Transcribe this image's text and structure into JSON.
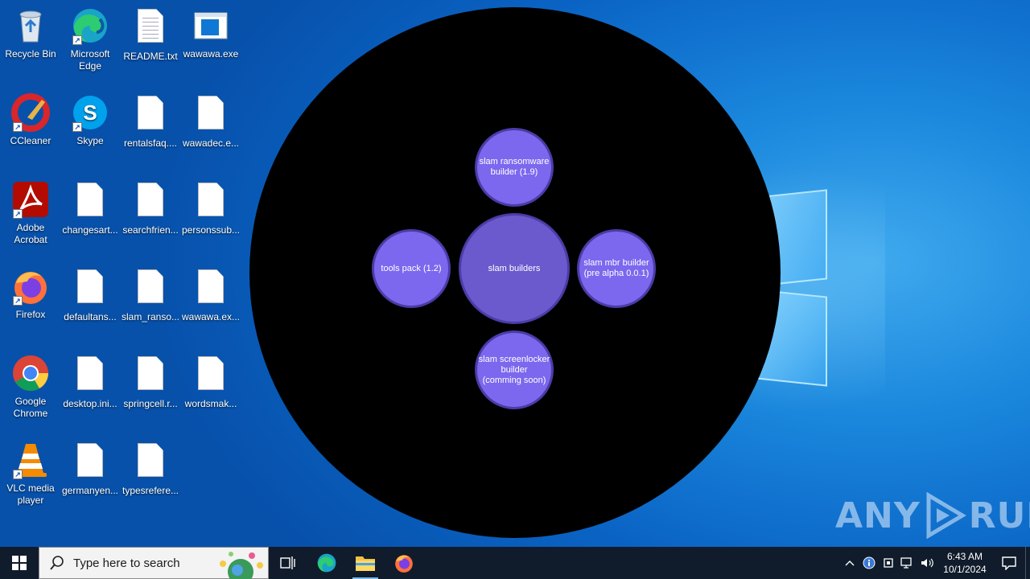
{
  "desktop": {
    "icons": [
      {
        "label": "Recycle Bin",
        "icon": "recycle-bin-icon"
      },
      {
        "label": "Microsoft Edge",
        "icon": "edge-icon"
      },
      {
        "label": "README.txt",
        "icon": "text-file-icon"
      },
      {
        "label": "wawawa.exe",
        "icon": "exe-window-icon"
      },
      {
        "label": "CCleaner",
        "icon": "ccleaner-icon"
      },
      {
        "label": "Skype",
        "icon": "skype-icon"
      },
      {
        "label": "rentalsfaq....",
        "icon": "file-icon"
      },
      {
        "label": "wawadec.e...",
        "icon": "file-icon"
      },
      {
        "label": "Adobe Acrobat",
        "icon": "acrobat-icon"
      },
      {
        "label": "changesart...",
        "icon": "file-icon"
      },
      {
        "label": "searchfrien...",
        "icon": "file-icon"
      },
      {
        "label": "personssub...",
        "icon": "file-icon"
      },
      {
        "label": "Firefox",
        "icon": "firefox-icon"
      },
      {
        "label": "defaultans...",
        "icon": "file-icon"
      },
      {
        "label": "slam_ranso...",
        "icon": "file-icon"
      },
      {
        "label": "wawawa.ex...",
        "icon": "file-icon"
      },
      {
        "label": "Google Chrome",
        "icon": "chrome-icon"
      },
      {
        "label": "desktop.ini...",
        "icon": "file-icon"
      },
      {
        "label": "springcell.r...",
        "icon": "file-icon"
      },
      {
        "label": "wordsmak...",
        "icon": "file-icon"
      },
      {
        "label": "VLC media player",
        "icon": "vlc-icon"
      },
      {
        "label": "germanyen...",
        "icon": "file-icon"
      },
      {
        "label": "typesrefere...",
        "icon": "file-icon"
      }
    ]
  },
  "app": {
    "center": "slam builders",
    "top": "slam ransomware\nbuilder (1.9)",
    "left": "tools pack (1.2)",
    "right": "slam mbr builder\n(pre alpha 0.0.1)",
    "bottom": "slam screenlocker\nbuilder\n(comming soon)"
  },
  "watermark": {
    "left": "ANY",
    "right": "RUN"
  },
  "taskbar": {
    "search_placeholder": "Type here to search",
    "apps": [
      "task-view-icon",
      "edge-icon",
      "file-explorer-icon",
      "firefox-icon"
    ],
    "time": "6:43 AM",
    "date": "10/1/2024"
  },
  "colors": {
    "bubble": "#7b68ee",
    "bubble_center": "#6a5acd",
    "bubble_border": "#4b3ca8",
    "taskbar": "#101c2b"
  }
}
